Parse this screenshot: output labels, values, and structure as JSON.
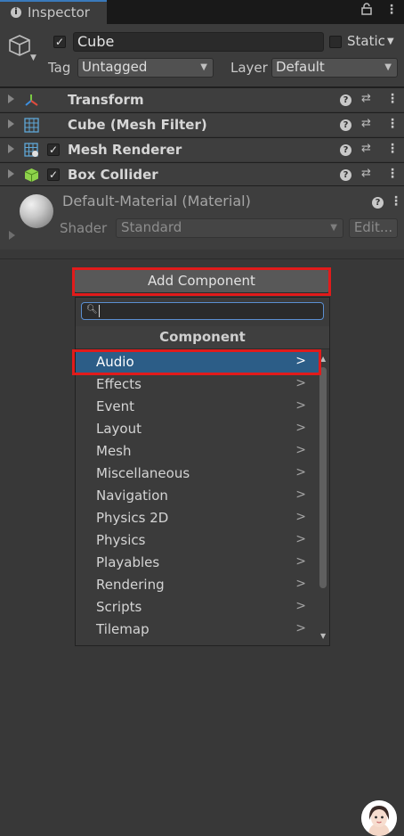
{
  "tab": {
    "title": "Inspector",
    "icon": "info-icon"
  },
  "header": {
    "object_name": "Cube",
    "active_checked": true,
    "static_label": "Static",
    "static_checked": false,
    "tag_label": "Tag",
    "tag_value": "Untagged",
    "layer_label": "Layer",
    "layer_value": "Default"
  },
  "components": [
    {
      "name": "Transform",
      "icon": "transform-icon",
      "has_checkbox": false
    },
    {
      "name": "Cube (Mesh Filter)",
      "icon": "mesh-filter-icon",
      "has_checkbox": false
    },
    {
      "name": "Mesh Renderer",
      "icon": "mesh-renderer-icon",
      "has_checkbox": true
    },
    {
      "name": "Box Collider",
      "icon": "box-collider-icon",
      "has_checkbox": true
    }
  ],
  "material": {
    "title": "Default-Material (Material)",
    "shader_label": "Shader",
    "shader_value": "Standard",
    "edit_label": "Edit..."
  },
  "add_component": {
    "button_label": "Add Component",
    "search_value": "",
    "header": "Component",
    "items": [
      {
        "label": "Audio",
        "selected": true
      },
      {
        "label": "Effects"
      },
      {
        "label": "Event"
      },
      {
        "label": "Layout"
      },
      {
        "label": "Mesh"
      },
      {
        "label": "Miscellaneous"
      },
      {
        "label": "Navigation"
      },
      {
        "label": "Physics 2D"
      },
      {
        "label": "Physics"
      },
      {
        "label": "Playables"
      },
      {
        "label": "Rendering"
      },
      {
        "label": "Scripts"
      },
      {
        "label": "Tilemap"
      }
    ]
  },
  "colors": {
    "highlight_red": "#e11b1b",
    "selection_blue": "#2c5d87",
    "background": "#383838"
  }
}
